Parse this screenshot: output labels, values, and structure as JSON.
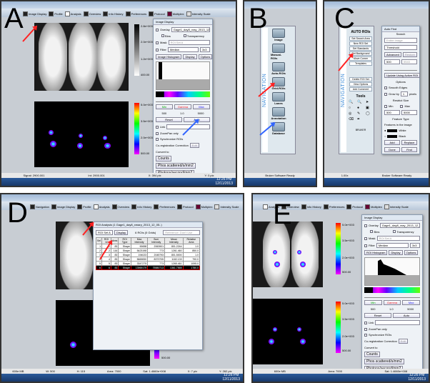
{
  "panels": {
    "a": {
      "letter": "A"
    },
    "b": {
      "letter": "B"
    },
    "c": {
      "letter": "C"
    },
    "d": {
      "letter": "D"
    },
    "e": {
      "letter": "E"
    }
  },
  "toolbar": [
    "Navigation",
    "Image Display",
    "Profile",
    "Analysis",
    "Overview",
    "Info History",
    "Preferences",
    "Protocol",
    "Multiplex",
    "Intensity Scale"
  ],
  "image_display": {
    "title": "Image Display",
    "overlay_label": "Overlay",
    "overlay_value": "Gage1_day8_xray_2013_12_05 (10..",
    "bins_label": "Bins",
    "transparency_label": "Transparency",
    "mask_label": "Mask",
    "mask_value": "ROI Set A",
    "filter_label": "Filter",
    "filter_value": "Median",
    "filter_size": "3x3",
    "histogram_label": "Image Histogram",
    "histogram_label_e": "ROI Histogram",
    "display_label": "Display",
    "options_label": "Options",
    "min_label": "Min",
    "gamma_label": "Gamma",
    "max_label": "Max",
    "min_value": "500",
    "gamma_value": "1.0",
    "max_value": "5000",
    "reset_label": "Reset",
    "auto_label": "Auto",
    "link_label": "Link",
    "zoompan_label": "ZoomPan only",
    "sync_label": "Synchronize ROIs",
    "coreg_label": "Co-registration Correction",
    "edit_label": "Edit",
    "convert_label": "Convert to",
    "counts_label": "Counts",
    "photons_label": "Phos scattered/s/mm2",
    "photons2_label": "Photons/second/mm2",
    "preferences_label": "Preferences..."
  },
  "colorbar_gray": [
    "2.8e+003",
    "2.0e+003",
    "1.2e+003",
    "400.00"
  ],
  "colorbar_color": [
    "5.0e+003",
    "3.5e+003",
    "2.0e+003",
    "500.00"
  ],
  "navigation": {
    "title": "NAVIGATION",
    "items": [
      "Image",
      "Manual-ROIs",
      "Auto-ROIs",
      "Grid-ROIs",
      "Lanes",
      "Annotation",
      "Database"
    ],
    "zoom": "1.00x",
    "status": "Bruker Software Ready"
  },
  "auto_rois": {
    "title": "AUTO ROIs",
    "buttons": [
      "Set Search Area",
      "New ROI Set",
      "Set Standards",
      "Set Background",
      "Move Corner",
      "Templates",
      "Delete ROI Set",
      "View Options",
      "Add Comment"
    ],
    "tools_title": "Tools",
    "logo": "BRUKER"
  },
  "auto_find": {
    "title": "Auto Find",
    "search_label": "Search",
    "search_value": "Entire Image",
    "method_value": "Threshold",
    "advanced_label": "Advanced",
    "restore_label": "Restore",
    "threshold_value": "500",
    "threshold_max": "5543",
    "update_label": "Update Using Active ROI",
    "options_label": "Options",
    "smooth_label": "Smooth Edges",
    "grow_label": "Grow by",
    "grow_value": "1",
    "grow_unit": "pixels",
    "restrict_label": "Restrict Size",
    "min_label": "Min",
    "max_label": "Max",
    "min_value": "500",
    "max_value": "5000",
    "feature_label": "Feature Type",
    "features_label": "Features in the image",
    "white_label": "White",
    "black_label": "Black",
    "add_label": "Add",
    "replace_label": "Replace",
    "done_label": "Done",
    "find_label": "Find"
  },
  "roi_analysis": {
    "title": "ROI Analysis (1 Gage1_day8_xmary_2013_12_05..)",
    "set_value": "ROI Set A",
    "display_label": "Display",
    "count_label": "6 ROIs (0 Grids)",
    "reference_label": "Reference: Don't Use",
    "headers": [
      "Sel",
      "ROI Id",
      "Area",
      "ROI Type",
      "Max Intensity",
      "Sum Intensity",
      "Mean Intensity",
      "Relative Area"
    ],
    "rows": [
      [
        "1",
        "1",
        "83",
        "Shape",
        "90658",
        "2063901",
        "801.2244",
        "1.0"
      ],
      [
        "2",
        "2",
        "116",
        "Shape",
        "5423198",
        "773",
        "1261.460",
        "850.0"
      ],
      [
        "3",
        "3",
        "83",
        "Shape",
        "194023",
        "2045793",
        "801.5000",
        "1.0"
      ],
      [
        "4",
        "4",
        "83",
        "Shape",
        "5669830",
        "8373705",
        "1182.133",
        "790.0"
      ],
      [
        "5",
        "5",
        "83",
        "Shape",
        "3347275",
        "773",
        "1265.461",
        "1095.0"
      ],
      [
        "6",
        "6",
        "83",
        "Shape",
        "13969179",
        "75580713",
        "1361.7565",
        "1780.0"
      ]
    ]
  },
  "status_a": [
    "Signal: 2900.001",
    "Int: 2900.001",
    "X: 394 pix",
    "Y: 0 pix"
  ],
  "status_d": [
    "600e MB",
    "W: 500",
    "H: 115",
    "Area: 7000",
    "Sat: 1.4660e+008",
    "X: 7 pix",
    "Y: 262 pix"
  ],
  "clock": {
    "time": "12:26 PM",
    "date": "12/11/2013"
  }
}
